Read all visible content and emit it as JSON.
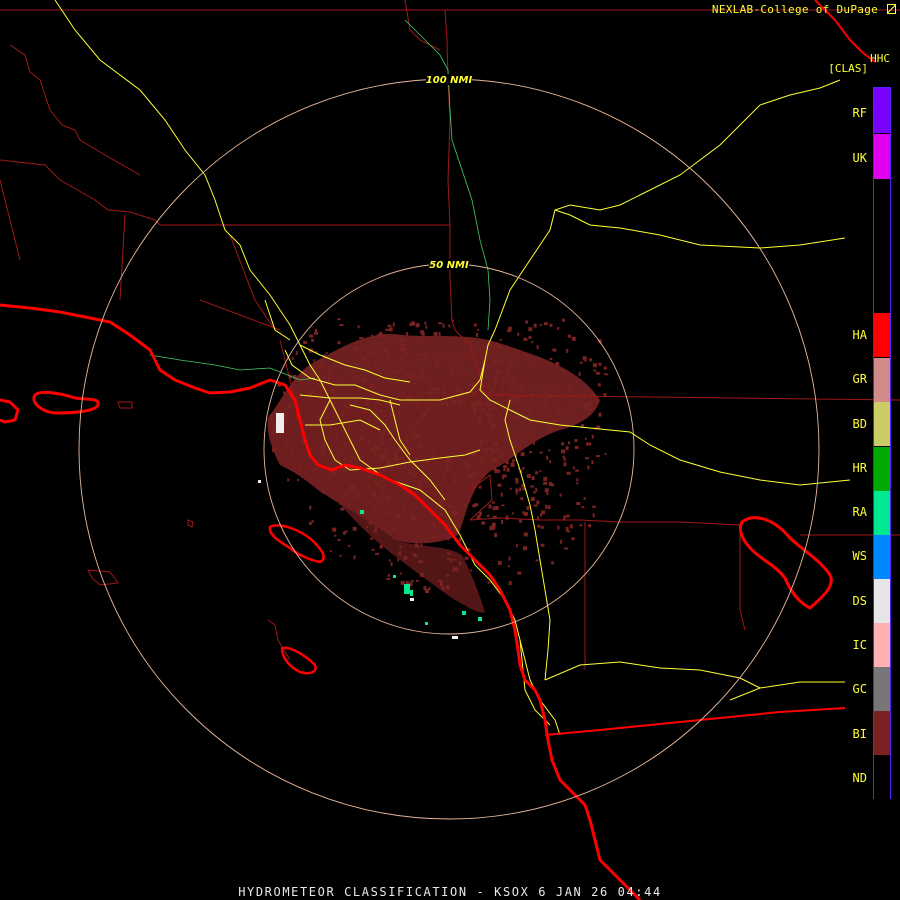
{
  "header": {
    "credit": "NEXLAB-College of DuPage",
    "credit_icon": "resize-corner-icon",
    "product_code": "HHC",
    "product_unit": "[CLAS]"
  },
  "range_rings": [
    {
      "label": "100 NMI"
    },
    {
      "label": "50 NMI"
    }
  ],
  "legend": [
    {
      "code": "RF",
      "color": "#7a00ff"
    },
    {
      "code": "UK",
      "color": "#e000f0"
    },
    {
      "code": "HA",
      "color": "#ff0000"
    },
    {
      "code": "GR",
      "color": "#d08a8a"
    },
    {
      "code": "BD",
      "color": "#cccc66"
    },
    {
      "code": "HR",
      "color": "#00aa00"
    },
    {
      "code": "RA",
      "color": "#00e890"
    },
    {
      "code": "WS",
      "color": "#0088ff"
    },
    {
      "code": "DS",
      "color": "#e6e6e6"
    },
    {
      "code": "IC",
      "color": "#ffb0b0"
    },
    {
      "code": "GC",
      "color": "#777777"
    },
    {
      "code": "BI",
      "color": "#7a2222"
    },
    {
      "code": "ND",
      "color": "#000000"
    }
  ],
  "colors": {
    "coastline": "#ff0000",
    "county_lines": "#a01818",
    "highways": "#ffff33",
    "rivers": "#44cc66",
    "range_rings": "#e8b89a",
    "echo_biological": "#7a2222"
  },
  "footer": {
    "title": "HYDROMETEOR CLASSIFICATION - KSOX 6 JAN 26 04:44"
  }
}
